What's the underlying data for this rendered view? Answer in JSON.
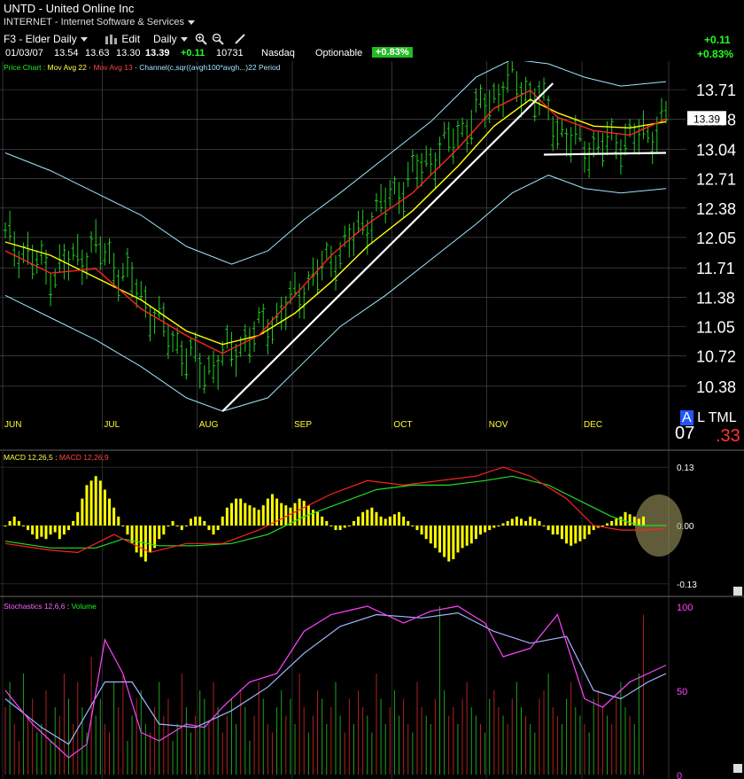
{
  "header": {
    "symbol_line": "UNTD - United Online Inc",
    "industry_menu": "INTERNET - Internet Software & Services",
    "layout_menu": "F3 - Elder Daily",
    "edit_label": "Edit",
    "period_menu": "Daily",
    "date": "01/03/07",
    "open": "13.54",
    "high": "13.63",
    "low": "13.30",
    "close": "13.39",
    "change": "+0.11",
    "volume": "10731",
    "exchange": "Nasdaq",
    "optionable": "Optionable",
    "pct_badge": "+0.83%",
    "right_change": "+0.11",
    "right_pct": "+0.83%"
  },
  "price_legend": {
    "chart": "Price Chart :",
    "ma22": "Mov Avg 22",
    "ma13": "Mov Avg 13",
    "channel": "Channel(c,sqr((avgh100*avgh...)22 Period"
  },
  "macd_legend": {
    "a": "MACD 12,26,5",
    "b": "MACD 12,26,9"
  },
  "stoch_legend": {
    "a": "Stochastics 12,6,6",
    "b": "Volume"
  },
  "status": {
    "a": "A",
    "l": "L",
    "t": "T",
    "m": "M",
    "l2": "L",
    "bottom_left": "07",
    "bottom_right": ".33"
  },
  "colors": {
    "bar_green": "#22cc22",
    "ma22": "#ffff00",
    "ma13": "#ff2222",
    "channel": "#9fe6ff",
    "macd_hist": "#ffff00",
    "stoch": "#ff44ff",
    "stoch_slow": "#a0b4ff",
    "badge": "#22bb22"
  },
  "chart_data": [
    {
      "type": "line",
      "name": "price",
      "ticker": "UNTD",
      "ylim": [
        10.1,
        13.95
      ],
      "y_ticks": [
        13.71,
        13.38,
        13.04,
        12.71,
        12.38,
        12.05,
        11.71,
        11.38,
        11.05,
        10.72,
        10.38
      ],
      "last_price_label": "13.39",
      "x_tick_labels": [
        "JUN",
        "JUL",
        "AUG",
        "SEP",
        "OCT",
        "NOV",
        "DEC"
      ],
      "x_tick_index": [
        0,
        22,
        43,
        64,
        86,
        107,
        128
      ],
      "points": [
        [
          0,
          12.05
        ],
        [
          10,
          11.65
        ],
        [
          20,
          11.95
        ],
        [
          28,
          11.55
        ],
        [
          36,
          10.95
        ],
        [
          44,
          10.55
        ],
        [
          52,
          10.85
        ],
        [
          60,
          11.15
        ],
        [
          68,
          11.6
        ],
        [
          76,
          12.0
        ],
        [
          84,
          12.45
        ],
        [
          92,
          12.85
        ],
        [
          100,
          13.2
        ],
        [
          106,
          13.55
        ],
        [
          112,
          13.8
        ],
        [
          118,
          13.6
        ],
        [
          124,
          13.15
        ],
        [
          130,
          13.05
        ],
        [
          136,
          13.15
        ],
        [
          142,
          13.2
        ],
        [
          146,
          13.39
        ]
      ],
      "ma22": [
        [
          0,
          12.0
        ],
        [
          10,
          11.85
        ],
        [
          20,
          11.6
        ],
        [
          30,
          11.35
        ],
        [
          40,
          11.0
        ],
        [
          48,
          10.85
        ],
        [
          56,
          10.95
        ],
        [
          64,
          11.2
        ],
        [
          72,
          11.55
        ],
        [
          80,
          11.95
        ],
        [
          90,
          12.35
        ],
        [
          100,
          12.85
        ],
        [
          108,
          13.3
        ],
        [
          116,
          13.6
        ],
        [
          122,
          13.45
        ],
        [
          130,
          13.3
        ],
        [
          138,
          13.28
        ],
        [
          146,
          13.35
        ]
      ],
      "ma13": [
        [
          0,
          11.9
        ],
        [
          10,
          11.65
        ],
        [
          20,
          11.7
        ],
        [
          30,
          11.25
        ],
        [
          40,
          10.95
        ],
        [
          48,
          10.75
        ],
        [
          56,
          10.95
        ],
        [
          64,
          11.4
        ],
        [
          72,
          11.85
        ],
        [
          80,
          12.2
        ],
        [
          90,
          12.55
        ],
        [
          100,
          13.05
        ],
        [
          108,
          13.5
        ],
        [
          116,
          13.7
        ],
        [
          122,
          13.4
        ],
        [
          130,
          13.25
        ],
        [
          138,
          13.2
        ],
        [
          146,
          13.38
        ]
      ],
      "channel_upper": [
        [
          0,
          13.0
        ],
        [
          10,
          12.8
        ],
        [
          20,
          12.55
        ],
        [
          30,
          12.3
        ],
        [
          40,
          11.95
        ],
        [
          50,
          11.75
        ],
        [
          58,
          11.9
        ],
        [
          66,
          12.25
        ],
        [
          74,
          12.55
        ],
        [
          84,
          12.95
        ],
        [
          94,
          13.35
        ],
        [
          104,
          13.85
        ],
        [
          112,
          14.05
        ],
        [
          120,
          14.0
        ],
        [
          128,
          13.85
        ],
        [
          136,
          13.75
        ],
        [
          146,
          13.8
        ]
      ],
      "channel_lower": [
        [
          0,
          11.4
        ],
        [
          10,
          11.15
        ],
        [
          20,
          10.9
        ],
        [
          30,
          10.6
        ],
        [
          40,
          10.25
        ],
        [
          48,
          10.1
        ],
        [
          58,
          10.25
        ],
        [
          66,
          10.65
        ],
        [
          74,
          11.05
        ],
        [
          84,
          11.4
        ],
        [
          94,
          11.8
        ],
        [
          104,
          12.2
        ],
        [
          112,
          12.55
        ],
        [
          120,
          12.75
        ],
        [
          128,
          12.6
        ],
        [
          136,
          12.55
        ],
        [
          146,
          12.6
        ]
      ],
      "trendlines": [
        {
          "from": [
            48,
            10.1
          ],
          "to": [
            121,
            13.78
          ]
        },
        {
          "from": [
            119,
            12.98
          ],
          "to": [
            146,
            13.0
          ]
        }
      ]
    },
    {
      "type": "bar",
      "name": "MACD histogram",
      "ylim": [
        -0.15,
        0.15
      ],
      "y_ticks": [
        0.13,
        0.0,
        -0.13
      ],
      "values": [
        0.0,
        0.01,
        0.02,
        0.01,
        0.0,
        -0.01,
        -0.02,
        -0.03,
        -0.025,
        -0.03,
        -0.02,
        -0.015,
        -0.03,
        -0.02,
        -0.01,
        0.01,
        0.03,
        0.06,
        0.09,
        0.1,
        0.11,
        0.1,
        0.08,
        0.06,
        0.04,
        0.02,
        0.0,
        -0.02,
        -0.04,
        -0.06,
        -0.07,
        -0.08,
        -0.06,
        -0.05,
        -0.03,
        -0.02,
        0.0,
        0.01,
        0.0,
        -0.01,
        0.0,
        0.015,
        0.02,
        0.02,
        0.01,
        -0.01,
        -0.02,
        -0.01,
        0.02,
        0.04,
        0.05,
        0.06,
        0.06,
        0.05,
        0.045,
        0.04,
        0.035,
        0.045,
        0.06,
        0.07,
        0.06,
        0.05,
        0.045,
        0.04,
        0.05,
        0.06,
        0.055,
        0.045,
        0.035,
        0.03,
        0.02,
        0.01,
        0.0,
        -0.01,
        -0.01,
        -0.005,
        0.0,
        0.01,
        0.02,
        0.03,
        0.035,
        0.04,
        0.03,
        0.02,
        0.015,
        0.02,
        0.025,
        0.03,
        0.02,
        0.01,
        0.0,
        -0.01,
        -0.02,
        -0.03,
        -0.04,
        -0.05,
        -0.06,
        -0.07,
        -0.08,
        -0.075,
        -0.06,
        -0.05,
        -0.045,
        -0.04,
        -0.03,
        -0.02,
        -0.015,
        -0.01,
        -0.005,
        0.0,
        0.005,
        0.01,
        0.015,
        0.02,
        0.015,
        0.01,
        0.02,
        0.015,
        0.01,
        0.0,
        -0.01,
        -0.02,
        -0.02,
        -0.03,
        -0.04,
        -0.045,
        -0.04,
        -0.035,
        -0.03,
        -0.02,
        -0.01,
        -0.005,
        0.0,
        0.005,
        0.01,
        0.015,
        0.02,
        0.03,
        0.025,
        0.02,
        0.015,
        0.02
      ],
      "macd_line": [
        [
          0,
          -0.04
        ],
        [
          10,
          -0.055
        ],
        [
          16,
          -0.06
        ],
        [
          24,
          -0.02
        ],
        [
          32,
          -0.06
        ],
        [
          40,
          -0.04
        ],
        [
          48,
          -0.04
        ],
        [
          56,
          -0.01
        ],
        [
          64,
          0.03
        ],
        [
          72,
          0.07
        ],
        [
          80,
          0.1
        ],
        [
          88,
          0.09
        ],
        [
          96,
          0.1
        ],
        [
          104,
          0.11
        ],
        [
          110,
          0.13
        ],
        [
          116,
          0.11
        ],
        [
          124,
          0.06
        ],
        [
          130,
          0.0
        ],
        [
          136,
          -0.01
        ],
        [
          142,
          -0.01
        ],
        [
          146,
          -0.005
        ]
      ],
      "signal_line": [
        [
          0,
          -0.035
        ],
        [
          10,
          -0.05
        ],
        [
          20,
          -0.05
        ],
        [
          26,
          -0.03
        ],
        [
          34,
          -0.045
        ],
        [
          42,
          -0.045
        ],
        [
          50,
          -0.04
        ],
        [
          58,
          -0.02
        ],
        [
          66,
          0.02
        ],
        [
          74,
          0.05
        ],
        [
          82,
          0.08
        ],
        [
          90,
          0.09
        ],
        [
          98,
          0.09
        ],
        [
          106,
          0.1
        ],
        [
          112,
          0.11
        ],
        [
          120,
          0.09
        ],
        [
          128,
          0.05
        ],
        [
          134,
          0.02
        ],
        [
          140,
          0.0
        ],
        [
          146,
          0.0
        ]
      ]
    },
    {
      "type": "line",
      "name": "Stochastics",
      "ylim": [
        0,
        100
      ],
      "y_ticks": [
        100,
        50,
        0
      ],
      "k": [
        [
          0,
          50
        ],
        [
          6,
          30
        ],
        [
          10,
          20
        ],
        [
          14,
          10
        ],
        [
          18,
          18
        ],
        [
          22,
          80
        ],
        [
          26,
          60
        ],
        [
          30,
          25
        ],
        [
          34,
          20
        ],
        [
          40,
          30
        ],
        [
          44,
          28
        ],
        [
          48,
          40
        ],
        [
          54,
          55
        ],
        [
          60,
          60
        ],
        [
          66,
          85
        ],
        [
          72,
          95
        ],
        [
          80,
          100
        ],
        [
          88,
          90
        ],
        [
          94,
          97
        ],
        [
          100,
          100
        ],
        [
          106,
          90
        ],
        [
          110,
          70
        ],
        [
          116,
          75
        ],
        [
          122,
          95
        ],
        [
          128,
          45
        ],
        [
          132,
          40
        ],
        [
          138,
          55
        ],
        [
          142,
          60
        ],
        [
          146,
          65
        ]
      ],
      "d": [
        [
          0,
          45
        ],
        [
          8,
          28
        ],
        [
          14,
          18
        ],
        [
          22,
          55
        ],
        [
          28,
          55
        ],
        [
          34,
          30
        ],
        [
          42,
          28
        ],
        [
          50,
          38
        ],
        [
          58,
          52
        ],
        [
          66,
          72
        ],
        [
          74,
          88
        ],
        [
          82,
          95
        ],
        [
          92,
          93
        ],
        [
          100,
          96
        ],
        [
          108,
          85
        ],
        [
          116,
          78
        ],
        [
          124,
          82
        ],
        [
          130,
          50
        ],
        [
          136,
          45
        ],
        [
          142,
          55
        ],
        [
          146,
          60
        ]
      ],
      "volume": [
        40,
        55,
        30,
        20,
        60,
        35,
        45,
        25,
        30,
        50,
        20,
        40,
        35,
        60,
        45,
        30,
        55,
        40,
        25,
        70,
        35,
        45,
        30,
        25,
        55,
        40,
        60,
        20,
        35,
        45,
        50,
        30,
        25,
        40,
        55,
        35,
        45,
        20,
        30,
        60,
        40,
        25,
        35,
        50,
        45,
        30,
        55,
        40,
        25,
        35,
        45,
        30,
        50,
        40,
        20,
        35,
        55,
        45,
        30,
        25,
        40,
        50,
        35,
        45,
        30,
        60,
        40,
        25,
        35,
        50,
        45,
        30,
        40,
        55,
        35,
        25,
        45,
        30,
        50,
        40,
        35,
        25,
        60,
        45,
        30,
        40,
        50,
        35,
        45,
        30,
        25,
        55,
        40,
        35,
        30,
        45,
        100,
        50,
        35,
        40,
        30,
        45,
        55,
        40,
        35,
        30,
        25,
        45,
        50,
        40,
        35,
        30,
        45,
        55,
        40,
        35,
        30,
        25,
        45,
        50,
        60,
        40,
        35,
        30,
        45,
        55,
        40,
        35,
        30,
        25,
        45,
        50,
        40,
        35,
        30,
        45,
        55,
        40,
        35,
        30,
        60,
        95
      ]
    }
  ]
}
